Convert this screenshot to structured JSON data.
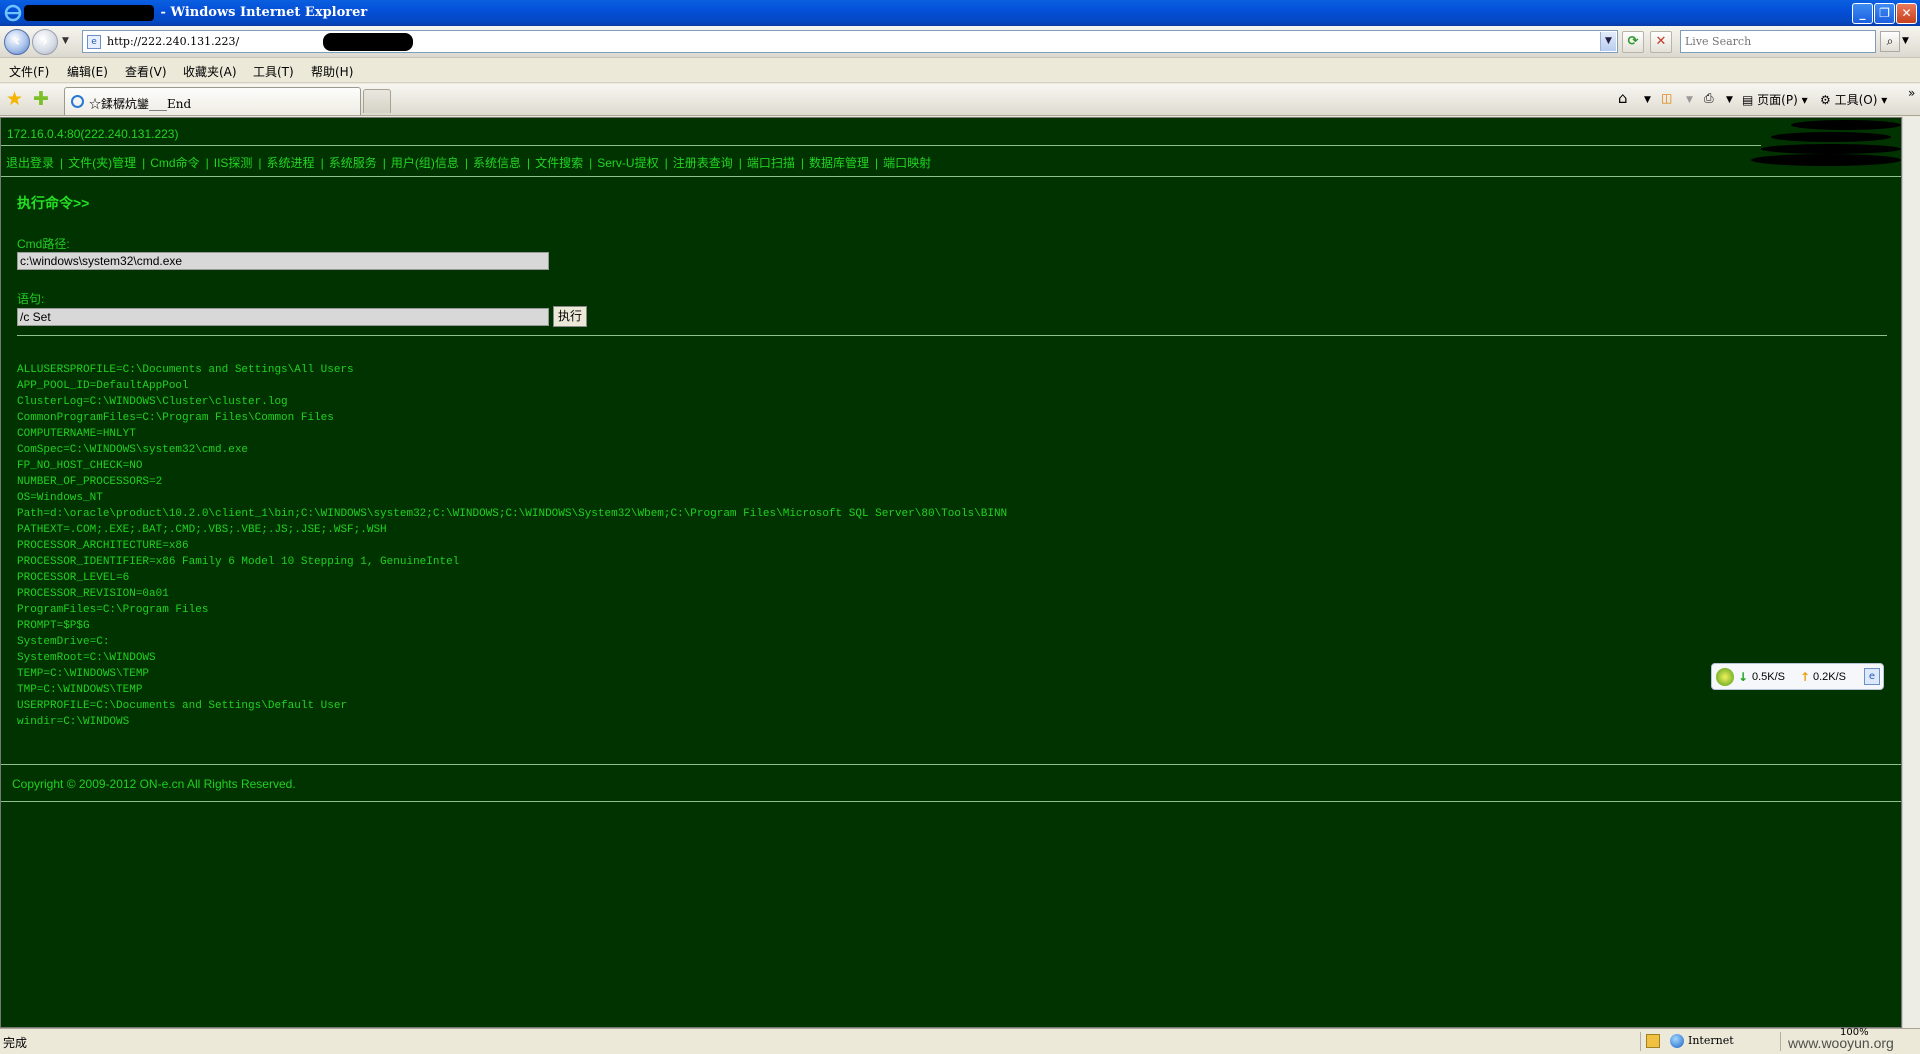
{
  "window": {
    "title": " - Windows Internet Explorer"
  },
  "address_bar": {
    "url": "http://222.240.131.223/",
    "search_placeholder": "Live Search"
  },
  "menu": {
    "items": [
      "文件(F)",
      "编辑(E)",
      "查看(V)",
      "收藏夹(A)",
      "工具(T)",
      "帮助(H)"
    ]
  },
  "tabs": {
    "active_label": "☆鍒樼炕鑾___End"
  },
  "command_bar": {
    "page_label": "页面(P)",
    "tools_label": "工具(O)"
  },
  "page": {
    "host": "172.16.0.4:80(222.240.131.223)",
    "nav_links": [
      "退出登录",
      "文件(夹)管理",
      "Cmd命令",
      "IIS探测",
      "系统进程",
      "系统服务",
      "用户(组)信息",
      "系统信息",
      "文件搜索",
      "Serv-U提权",
      "注册表查询",
      "端口扫描",
      "数据库管理",
      "端口映射"
    ],
    "section_title": "执行命令>>",
    "cmd_path_label": "Cmd路径:",
    "cmd_path_value": "c:\\windows\\system32\\cmd.exe",
    "statement_label": "语句:",
    "statement_value": "/c Set",
    "exec_button": "执行",
    "output_lines": [
      "ALLUSERSPROFILE=C:\\Documents and Settings\\All Users",
      "APP_POOL_ID=DefaultAppPool",
      "ClusterLog=C:\\WINDOWS\\Cluster\\cluster.log",
      "CommonProgramFiles=C:\\Program Files\\Common Files",
      "COMPUTERNAME=HNLYT",
      "ComSpec=C:\\WINDOWS\\system32\\cmd.exe",
      "FP_NO_HOST_CHECK=NO",
      "NUMBER_OF_PROCESSORS=2",
      "OS=Windows_NT",
      "Path=d:\\oracle\\product\\10.2.0\\client_1\\bin;C:\\WINDOWS\\system32;C:\\WINDOWS;C:\\WINDOWS\\System32\\Wbem;C:\\Program Files\\Microsoft SQL Server\\80\\Tools\\BINN",
      "PATHEXT=.COM;.EXE;.BAT;.CMD;.VBS;.VBE;.JS;.JSE;.WSF;.WSH",
      "PROCESSOR_ARCHITECTURE=x86",
      "PROCESSOR_IDENTIFIER=x86 Family 6 Model 10 Stepping 1, GenuineIntel",
      "PROCESSOR_LEVEL=6",
      "PROCESSOR_REVISION=0a01",
      "ProgramFiles=C:\\Program Files",
      "PROMPT=$P$G",
      "SystemDrive=C:",
      "SystemRoot=C:\\WINDOWS",
      "TEMP=C:\\WINDOWS\\TEMP",
      "TMP=C:\\WINDOWS\\TEMP",
      "USERPROFILE=C:\\Documents and Settings\\Default User",
      "windir=C:\\WINDOWS"
    ],
    "copyright": "Copyright © 2009-2012 ON-e.cn All Rights Reserved."
  },
  "net_widget": {
    "download": "0.5K/S",
    "upload": "0.2K/S"
  },
  "status_bar": {
    "status": "完成",
    "zone": "Internet",
    "zoom": "100%",
    "watermark": "www.wooyun.org"
  },
  "colors": {
    "page_background": "#003300",
    "page_text": "#22d022",
    "titlebar": "#0550d8"
  }
}
